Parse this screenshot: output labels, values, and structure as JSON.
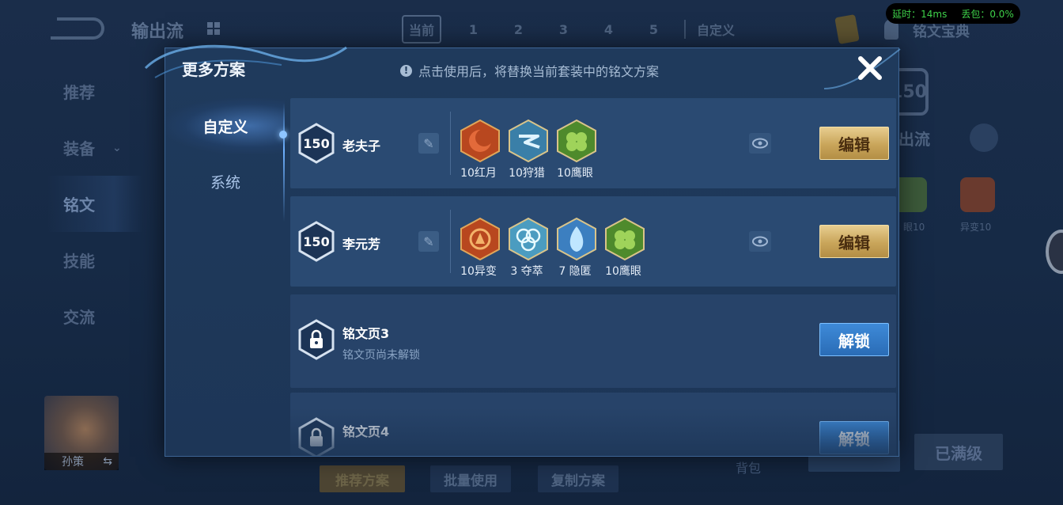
{
  "background": {
    "title": "输出流",
    "tabs": [
      "当前",
      "1",
      "2",
      "3",
      "4",
      "5",
      "自定义"
    ],
    "rune_dict": "铭文宝典",
    "status": {
      "latency": "延时：14ms",
      "packet_loss": "丢包：0.0%"
    },
    "side_nav": [
      "推荐",
      "装备",
      "铭文",
      "技能",
      "交流"
    ],
    "hero_name": "孙策",
    "swap_icon": "⇆",
    "bottom_buttons": [
      "推荐方案",
      "批量使用",
      "复制方案"
    ],
    "bag": "背包",
    "max_level": "已满级",
    "right_level": "150",
    "right_name": "出流",
    "right_rune_labels": [
      "眼10",
      "异变10"
    ]
  },
  "dialog": {
    "title": "更多方案",
    "hint": "点击使用后，将替换当前套装中的铭文方案",
    "tabs": [
      "自定义",
      "系统"
    ],
    "plans": [
      {
        "level": "150",
        "name": "老夫子",
        "runes": [
          {
            "label": "10红月",
            "color": "#d2502a",
            "icon": "red-moon-rune-icon"
          },
          {
            "label": "10狩猎",
            "color": "#4aa3c8",
            "icon": "hunt-rune-icon"
          },
          {
            "label": "10鹰眼",
            "color": "#6fa83a",
            "icon": "eagle-eye-rune-icon"
          }
        ],
        "button": "编辑"
      },
      {
        "level": "150",
        "name": "李元芳",
        "runes": [
          {
            "label": "10异变",
            "color": "#d2502a",
            "icon": "mutation-rune-icon"
          },
          {
            "label": "3 夺萃",
            "color": "#58b0d0",
            "icon": "plunder-rune-icon"
          },
          {
            "label": "7 隐匿",
            "color": "#4a8fd0",
            "icon": "stealth-rune-icon"
          },
          {
            "label": "10鹰眼",
            "color": "#6fa83a",
            "icon": "eagle-eye-rune-icon"
          }
        ],
        "button": "编辑"
      }
    ],
    "locked_pages": [
      {
        "title": "铭文页3",
        "subtitle": "铭文页尚未解锁",
        "button": "解锁"
      },
      {
        "title": "铭文页4",
        "subtitle": "",
        "button": "解锁"
      }
    ]
  }
}
